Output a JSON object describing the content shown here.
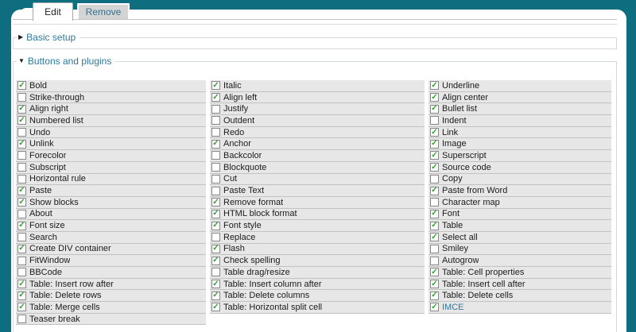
{
  "colors": {
    "page_background": "#0e6e80",
    "panel_background": "#ffffff",
    "row_background": "#e7e7e7",
    "row_border": "#c2c2c2",
    "accent_link": "#2c7a9c",
    "check_green": "#2f9e2f",
    "inactive_tab": "#d4d4d4"
  },
  "icons": {
    "check": "✓",
    "collapsed_arrow": "▶",
    "expanded_arrow": "▼"
  },
  "tabs": [
    {
      "label": "Edit",
      "active": true
    },
    {
      "label": "Remove",
      "active": false
    }
  ],
  "sections": [
    {
      "label": "Basic setup",
      "collapsed": true
    },
    {
      "label": "Buttons and plugins",
      "collapsed": false
    }
  ],
  "checkbox_grid": {
    "columns": [
      {
        "items": [
          {
            "label": "Bold",
            "checked": true
          },
          {
            "label": "Strike-through",
            "checked": false
          },
          {
            "label": "Align right",
            "checked": true
          },
          {
            "label": "Numbered list",
            "checked": true
          },
          {
            "label": "Undo",
            "checked": false
          },
          {
            "label": "Unlink",
            "checked": true
          },
          {
            "label": "Forecolor",
            "checked": false
          },
          {
            "label": "Subscript",
            "checked": false
          },
          {
            "label": "Horizontal rule",
            "checked": false
          },
          {
            "label": "Paste",
            "checked": true
          },
          {
            "label": "Show blocks",
            "checked": true
          },
          {
            "label": "About",
            "checked": false
          },
          {
            "label": "Font size",
            "checked": true
          },
          {
            "label": "Search",
            "checked": false
          },
          {
            "label": "Create DIV container",
            "checked": true
          },
          {
            "label": "FitWindow",
            "checked": false
          },
          {
            "label": "BBCode",
            "checked": false
          },
          {
            "label": "Table: Insert row after",
            "checked": true
          },
          {
            "label": "Table: Delete rows",
            "checked": true
          },
          {
            "label": "Table: Merge cells",
            "checked": true
          },
          {
            "label": "Teaser break",
            "checked": false
          }
        ]
      },
      {
        "items": [
          {
            "label": "Italic",
            "checked": true
          },
          {
            "label": "Align left",
            "checked": true
          },
          {
            "label": "Justify",
            "checked": false
          },
          {
            "label": "Outdent",
            "checked": false
          },
          {
            "label": "Redo",
            "checked": false
          },
          {
            "label": "Anchor",
            "checked": true
          },
          {
            "label": "Backcolor",
            "checked": false
          },
          {
            "label": "Blockquote",
            "checked": false
          },
          {
            "label": "Cut",
            "checked": false
          },
          {
            "label": "Paste Text",
            "checked": false
          },
          {
            "label": "Remove format",
            "checked": true
          },
          {
            "label": "HTML block format",
            "checked": true
          },
          {
            "label": "Font style",
            "checked": true
          },
          {
            "label": "Replace",
            "checked": false
          },
          {
            "label": "Flash",
            "checked": true
          },
          {
            "label": "Check spelling",
            "checked": true
          },
          {
            "label": "Table drag/resize",
            "checked": false
          },
          {
            "label": "Table: Insert column after",
            "checked": true
          },
          {
            "label": "Table: Delete columns",
            "checked": true
          },
          {
            "label": "Table: Horizontal split cell",
            "checked": true
          }
        ]
      },
      {
        "items": [
          {
            "label": "Underline",
            "checked": true
          },
          {
            "label": "Align center",
            "checked": true
          },
          {
            "label": "Bullet list",
            "checked": true
          },
          {
            "label": "Indent",
            "checked": false
          },
          {
            "label": "Link",
            "checked": true
          },
          {
            "label": "Image",
            "checked": true
          },
          {
            "label": "Superscript",
            "checked": true
          },
          {
            "label": "Source code",
            "checked": true
          },
          {
            "label": "Copy",
            "checked": false
          },
          {
            "label": "Paste from Word",
            "checked": true
          },
          {
            "label": "Character map",
            "checked": false
          },
          {
            "label": "Font",
            "checked": true
          },
          {
            "label": "Table",
            "checked": true
          },
          {
            "label": "Select all",
            "checked": true
          },
          {
            "label": "Smiley",
            "checked": false
          },
          {
            "label": "Autogrow",
            "checked": false
          },
          {
            "label": "Table: Cell properties",
            "checked": true
          },
          {
            "label": "Table: Insert cell after",
            "checked": true
          },
          {
            "label": "Table: Delete cells",
            "checked": true
          },
          {
            "label": "IMCE",
            "checked": true,
            "link": true
          }
        ]
      }
    ]
  }
}
